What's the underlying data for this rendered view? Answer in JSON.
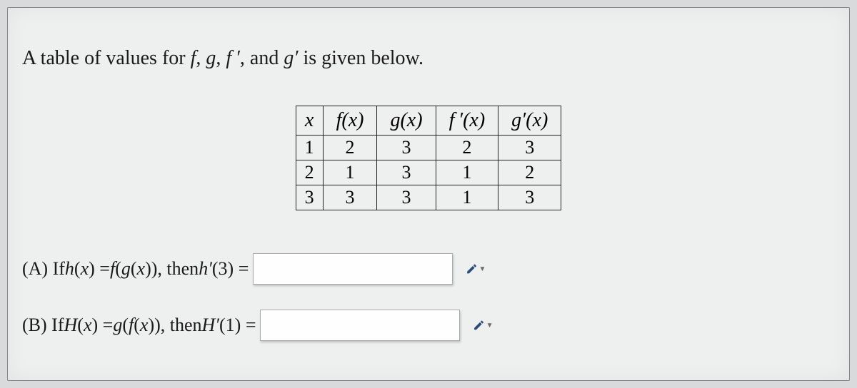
{
  "intro_prefix": "A table of values for ",
  "intro_f": "f",
  "intro_sep1": ", ",
  "intro_g": "g",
  "intro_sep2": ", ",
  "intro_fp": "f ′",
  "intro_sep3": ", and ",
  "intro_gp": "g′",
  "intro_suffix": " is given below.",
  "headers": {
    "x": "x",
    "fx": "f(x)",
    "gx": "g(x)",
    "fpx": "f ′(x)",
    "gpx": "g′(x)"
  },
  "rows": [
    {
      "x": "1",
      "fx": "2",
      "gx": "3",
      "fpx": "2",
      "gpx": "3"
    },
    {
      "x": "2",
      "fx": "1",
      "gx": "3",
      "fpx": "1",
      "gpx": "2"
    },
    {
      "x": "3",
      "fx": "3",
      "gx": "3",
      "fpx": "1",
      "gpx": "3"
    }
  ],
  "qA": {
    "label": "(A) If ",
    "h": "h",
    "open": "(",
    "x": "x",
    "close": ") = ",
    "f": "f",
    "open2": "(",
    "g": "g",
    "open3": "(",
    "x2": "x",
    "close3": "))",
    "then": ", then ",
    "hp": "h′",
    "open4": "(3) ="
  },
  "qB": {
    "label": "(B) If ",
    "H": "H",
    "open": "(",
    "x": "x",
    "close": ") = ",
    "g": "g",
    "open2": "(",
    "f": "f",
    "open3": "(",
    "x2": "x",
    "close3": "))",
    "then": ", then ",
    "Hp": "H′",
    "open4": "(1) ="
  },
  "answer_a": "",
  "answer_b": ""
}
